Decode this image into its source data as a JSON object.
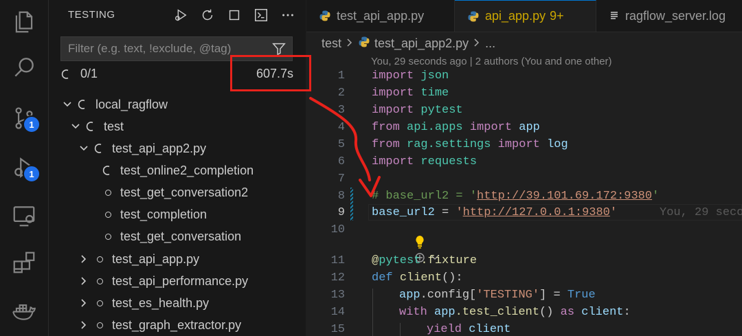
{
  "activity_bar": {
    "items": [
      {
        "name": "explorer"
      },
      {
        "name": "search"
      },
      {
        "name": "source-control",
        "badge": "1"
      },
      {
        "name": "run-and-debug",
        "badge": "1"
      },
      {
        "name": "remote-explorer"
      },
      {
        "name": "extensions"
      },
      {
        "name": "docker"
      }
    ]
  },
  "sidebar": {
    "title": "TESTING",
    "filter_placeholder": "Filter (e.g. text, !exclude, @tag)",
    "summary_count": "0/1",
    "elapsed": "607.7s",
    "tree": [
      {
        "label": "local_ragflow",
        "status": "running",
        "expanded": true
      },
      {
        "label": "test",
        "status": "running",
        "expanded": true
      },
      {
        "label": "test_api_app2.py",
        "status": "running",
        "expanded": true
      },
      {
        "label": "test_online2_completion",
        "status": "running"
      },
      {
        "label": "test_get_conversation2",
        "status": "idle"
      },
      {
        "label": "test_completion",
        "status": "idle"
      },
      {
        "label": "test_get_conversation",
        "status": "idle"
      },
      {
        "label": "test_api_app.py",
        "status": "idle",
        "expanded": false
      },
      {
        "label": "test_api_performance.py",
        "status": "idle",
        "expanded": false
      },
      {
        "label": "test_es_health.py",
        "status": "idle",
        "expanded": false
      },
      {
        "label": "test_graph_extractor.py",
        "status": "idle",
        "expanded": false
      }
    ]
  },
  "editor": {
    "tabs": [
      {
        "label": "test_api_app.py",
        "icon": "python-icon"
      },
      {
        "label": "api_app.py",
        "modified": "9+",
        "icon": "python-icon"
      },
      {
        "label": "ragflow_server.log",
        "icon": "log-file-icon"
      }
    ],
    "breadcrumb": {
      "folder": "test",
      "file": "test_api_app2.py",
      "more": "..."
    },
    "blame_header": "You, 29 seconds ago | 2 authors (You and one other)",
    "inline_blame": "You, 29 seco",
    "line_numbers": [
      "1",
      "2",
      "3",
      "4",
      "5",
      "6",
      "7",
      "8",
      "9",
      "10",
      "11",
      "12",
      "13",
      "14",
      "15"
    ],
    "code": {
      "l1": {
        "kw": "import",
        "mod": "json"
      },
      "l2": {
        "kw": "import",
        "mod": "time"
      },
      "l3": {
        "kw": "import",
        "mod": "pytest"
      },
      "l4": {
        "kw1": "from",
        "mod": "api.apps",
        "kw2": "import",
        "name": "app"
      },
      "l5": {
        "kw1": "from",
        "mod": "rag.settings",
        "kw2": "import",
        "name": "log"
      },
      "l6": {
        "kw": "import",
        "mod": "requests"
      },
      "l8": {
        "comment": "# base_url2 = '",
        "url": "http://39.101.69.172:9380",
        "end": "'"
      },
      "l9": {
        "var": "base_url2",
        "op": " = ",
        "q1": "'",
        "url": "http://127.0.0.1:9380",
        "q2": "'"
      },
      "l11": {
        "at": "@",
        "mod": "pytest",
        "dec": ".fixture"
      },
      "l12": {
        "kw": "def",
        "fn": "client",
        "rest": "():"
      },
      "l13": {
        "var": "app",
        "rest": ".config[",
        "str": "'TESTING'",
        "rest2": "] = ",
        "const": "True"
      },
      "l14": {
        "kw": "with",
        "var": "app",
        "fn": ".test_client",
        "rest": "() ",
        "kw2": "as",
        "var2": "client",
        "colon": ":"
      },
      "l15": {
        "kw": "yield",
        "var": "client"
      }
    }
  },
  "colors": {
    "accent": "#0078d4",
    "badge": "#1f6feb",
    "annotation_red": "#e8221b"
  }
}
